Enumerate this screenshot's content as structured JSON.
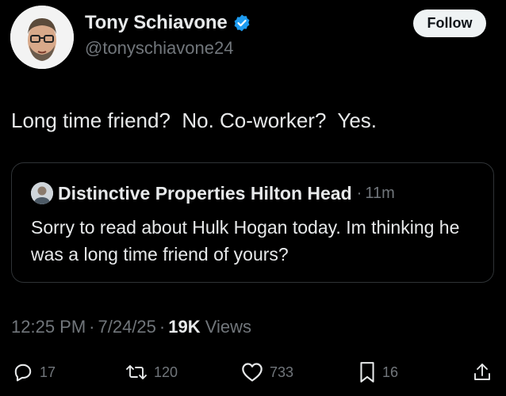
{
  "header": {
    "display_name": "Tony Schiavone",
    "handle": "@tonyschiavone24",
    "follow_label": "Follow"
  },
  "tweet": {
    "text": "Long time friend?  No. Co-worker?  Yes."
  },
  "quote": {
    "author_name": "Distinctive Properties Hilton Head",
    "dot": "·",
    "time": "11m",
    "text": "Sorry to read about Hulk Hogan today. Im thinking he was a long time friend of yours?"
  },
  "meta": {
    "time": "12:25 PM",
    "date": "7/24/25",
    "views_count": "19K",
    "views_label": "Views",
    "sep": "·"
  },
  "actions": {
    "replies": "17",
    "reposts": "120",
    "likes": "733",
    "bookmarks": "16"
  },
  "colors": {
    "background": "#000000",
    "text": "#e7e9ea",
    "muted": "#71767b",
    "verified": "#1d9bf0",
    "border": "#2f3336"
  },
  "icons": {
    "verified": "verified-badge-icon",
    "reply": "reply-icon",
    "repost": "repost-icon",
    "like": "heart-icon",
    "bookmark": "bookmark-icon",
    "share": "share-icon"
  }
}
